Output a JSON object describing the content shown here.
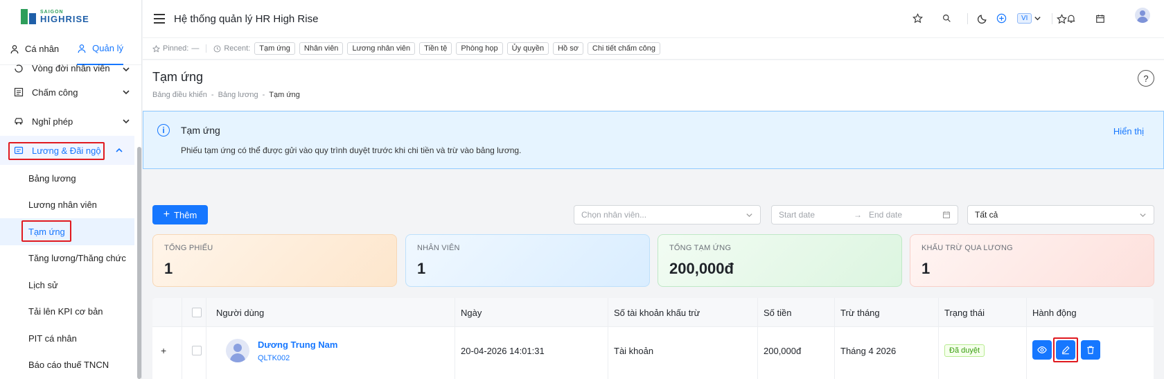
{
  "brand": {
    "line1": "SAIGON",
    "line2": "HIGHRISE"
  },
  "header": {
    "title": "Hệ thống quản lý HR High Rise",
    "lang": "VI"
  },
  "sidebar": {
    "tabs": [
      {
        "label": "Cá nhân"
      },
      {
        "label": "Quản lý"
      }
    ],
    "items": [
      {
        "label": "Vòng đời nhân viên"
      },
      {
        "label": "Chấm công"
      },
      {
        "label": "Nghỉ phép"
      },
      {
        "label": "Lương & Đãi ngộ"
      }
    ],
    "sub_items": [
      {
        "label": "Bảng lương"
      },
      {
        "label": "Lương nhân viên"
      },
      {
        "label": "Tạm ứng"
      },
      {
        "label": "Tăng lương/Thăng chức"
      },
      {
        "label": "Lịch sử"
      },
      {
        "label": "Tải lên KPI cơ bản"
      },
      {
        "label": "PIT cá nhân"
      },
      {
        "label": "Báo cáo thuế TNCN"
      }
    ]
  },
  "recent_bar": {
    "pinned_label": "Pinned:",
    "pinned_value": "—",
    "recent_label": "Recent:",
    "chips": [
      "Tạm ứng",
      "Nhân viên",
      "Lương nhân viên",
      "Tiền tệ",
      "Phòng họp",
      "Ủy quyền",
      "Hồ sơ",
      "Chi tiết chấm công"
    ]
  },
  "page": {
    "title": "Tạm ứng",
    "breadcrumb": [
      "Bảng điều khiển",
      "Bảng lương",
      "Tạm ứng"
    ],
    "breadcrumb_sep": "-"
  },
  "alert": {
    "title": "Tạm ứng",
    "description": "Phiếu tạm ứng có thể được gửi vào quy trình duyệt trước khi chi tiền và trừ vào bảng lương.",
    "link": "Hiển thị"
  },
  "toolbar": {
    "add_label": "Thêm",
    "employee_placeholder": "Chọn nhân viên...",
    "start_placeholder": "Start date",
    "end_placeholder": "End date",
    "status_value": "Tất cả"
  },
  "stats": [
    {
      "label": "TỔNG PHIẾU",
      "value": "1"
    },
    {
      "label": "NHÂN VIÊN",
      "value": "1"
    },
    {
      "label": "TỔNG TẠM ỨNG",
      "value": "200,000đ"
    },
    {
      "label": "KHẤU TRỪ QUA LƯƠNG",
      "value": "1"
    }
  ],
  "table": {
    "columns": [
      "Người dùng",
      "Ngày",
      "Số tài khoản khấu trừ",
      "Số tiền",
      "Trừ tháng",
      "Trạng thái",
      "Hành động"
    ],
    "rows": [
      {
        "expand": "+",
        "user_name": "Dương Trung Nam",
        "user_code": "QLTK002",
        "date": "20-04-2026 14:01:31",
        "account": "Tài khoản",
        "amount": "200,000đ",
        "month": "Tháng 4 2026",
        "status": "Đã duyệt"
      }
    ]
  },
  "colors": {
    "primary": "#1677ff",
    "highlight": "#e0191f",
    "success": "#389e0d"
  }
}
